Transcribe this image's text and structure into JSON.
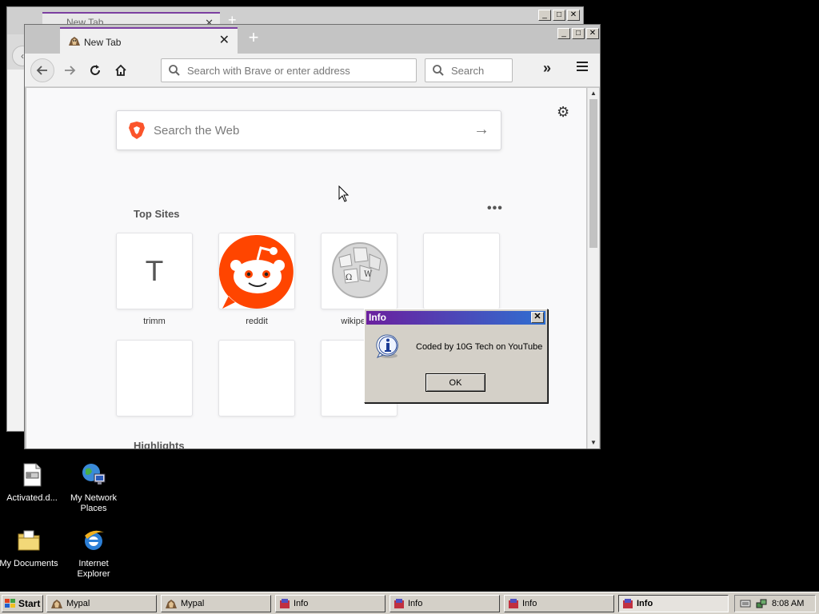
{
  "background_window": {
    "tab_title": "New Tab"
  },
  "browser": {
    "tab_title": "New Tab",
    "tab_close": "✕",
    "new_tab": "+",
    "urlbar_placeholder": "Search with Brave or enter address",
    "searchbar_placeholder": "Search",
    "overflow": "»",
    "web_search_placeholder": "Search the Web",
    "top_sites_label": "Top Sites",
    "top_sites_more": "•••",
    "highlights_label": "Highlights",
    "top_sites": [
      {
        "label": "trimm",
        "letter": "T",
        "icon": "letter-tile"
      },
      {
        "label": "reddit",
        "icon": "reddit-logo"
      },
      {
        "label": "wikipedia",
        "icon": "wikipedia-logo"
      },
      {
        "label": "",
        "icon": "empty"
      },
      {
        "label": "",
        "icon": "empty"
      },
      {
        "label": "",
        "icon": "empty"
      },
      {
        "label": "",
        "icon": "empty"
      }
    ]
  },
  "dialog": {
    "title": "Info",
    "close": "✕",
    "message": "Coded by 10G Tech on YouTube",
    "ok_label": "OK",
    "icon": "info-icon"
  },
  "desktop_icons": [
    {
      "label": "Activated.d...",
      "icon": "document-icon"
    },
    {
      "label": "My Network Places",
      "icon": "network-places-icon"
    },
    {
      "label": "My Documents",
      "icon": "folder-icon"
    },
    {
      "label": "Internet Explorer",
      "icon": "ie-icon"
    }
  ],
  "taskbar": {
    "start_label": "Start",
    "items": [
      {
        "label": "Mypal",
        "icon": "mypal-icon"
      },
      {
        "label": "Mypal",
        "icon": "mypal-icon"
      },
      {
        "label": "Info",
        "icon": "app-icon"
      },
      {
        "label": "Info",
        "icon": "app-icon"
      },
      {
        "label": "Info",
        "icon": "app-icon"
      },
      {
        "label": "Info",
        "icon": "app-icon",
        "active": true
      }
    ],
    "clock": "8:08 AM"
  },
  "colors": {
    "tab_accent": "#7c3fa3",
    "dialog_title_start": "#6b1f9e",
    "dialog_title_end": "#2e6fd1",
    "reddit_orange": "#ff4500",
    "brave_orange": "#fb542b"
  }
}
